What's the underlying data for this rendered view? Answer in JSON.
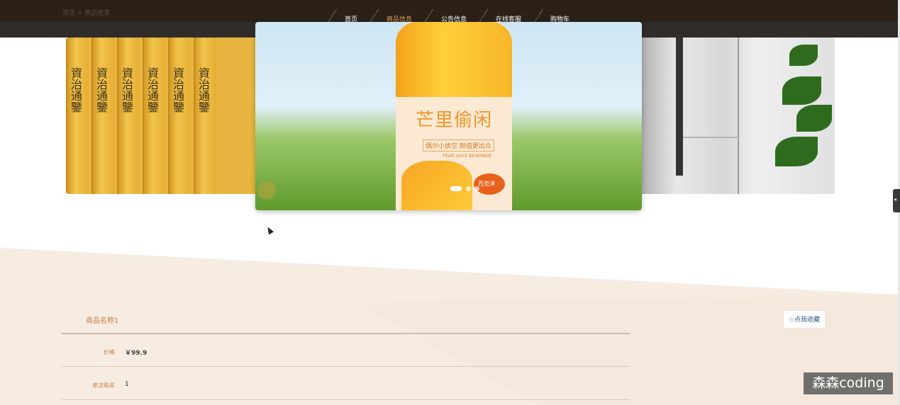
{
  "header": {
    "breadcrumb": "首页 > 商品信息",
    "nav": [
      {
        "label": "首页"
      },
      {
        "label": "商品信息",
        "active": true
      },
      {
        "label": "公告信息"
      },
      {
        "label": "在线客服"
      },
      {
        "label": "购物车"
      }
    ]
  },
  "carousel": {
    "left_slide": {
      "book_text": "資治通鑒"
    },
    "center_slide": {
      "title": "芒里偷闲",
      "subtitle": "偶尔小放空 颜值更出众",
      "english": "FRUIT JUICE BEVERAGE",
      "badge": "百克淳"
    },
    "active_index": 0,
    "dot_count": 3
  },
  "product": {
    "name": "商品名称1",
    "favorite_label": "☆点我收藏",
    "rows": [
      {
        "label": "价格",
        "value": "￥99.9"
      },
      {
        "label": "单次购买",
        "value": "1"
      }
    ]
  },
  "watermark": "森森coding",
  "colors": {
    "nav_bg": "#2c2118",
    "accent": "#c47f3f",
    "beige": "#f7ece2"
  }
}
